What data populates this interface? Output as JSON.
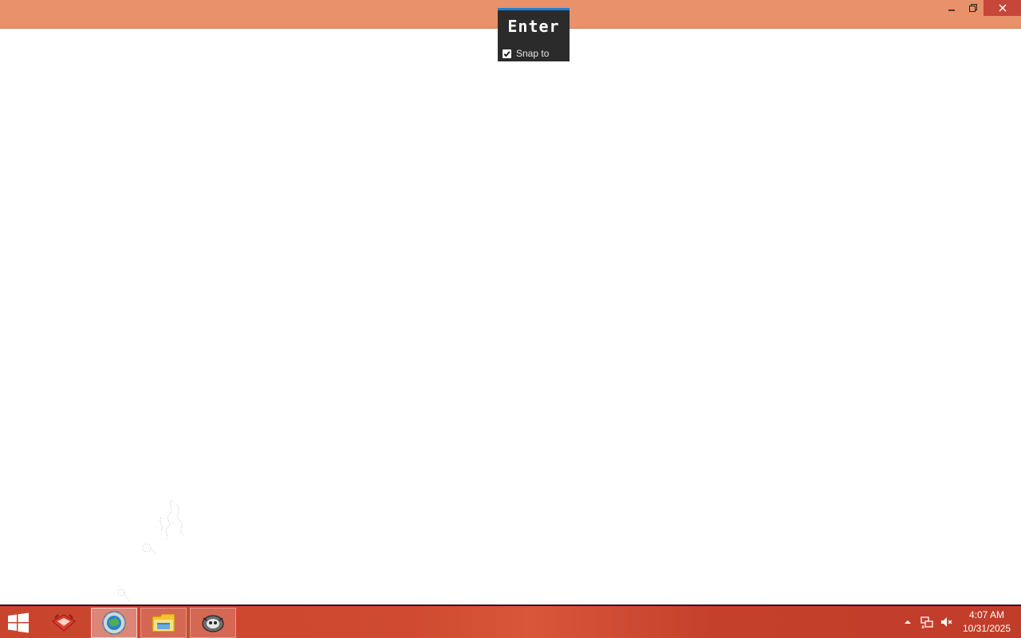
{
  "popup": {
    "title": "Enter",
    "snap_label": "Snap to",
    "snap_checked": true
  },
  "window_controls": {
    "minimize_icon": "minimize-icon",
    "restore_icon": "restore-icon",
    "close_icon": "close-icon"
  },
  "colors": {
    "titlebar": "#e8916a",
    "taskbar": "#c9442d",
    "close_button": "#c7463a",
    "popup_accent": "#1e7fd6"
  },
  "taskbar": {
    "items": [
      {
        "icon": "red-app-icon"
      },
      {
        "icon": "browser-globe-icon"
      },
      {
        "icon": "file-explorer-icon"
      },
      {
        "icon": "gimp-icon"
      }
    ]
  },
  "tray": {
    "overflow_icon": "chevron-up-icon",
    "network_icon": "network-icon",
    "volume_icon": "volume-muted-icon",
    "time": "4:07 AM",
    "date": "10/31/2025"
  }
}
